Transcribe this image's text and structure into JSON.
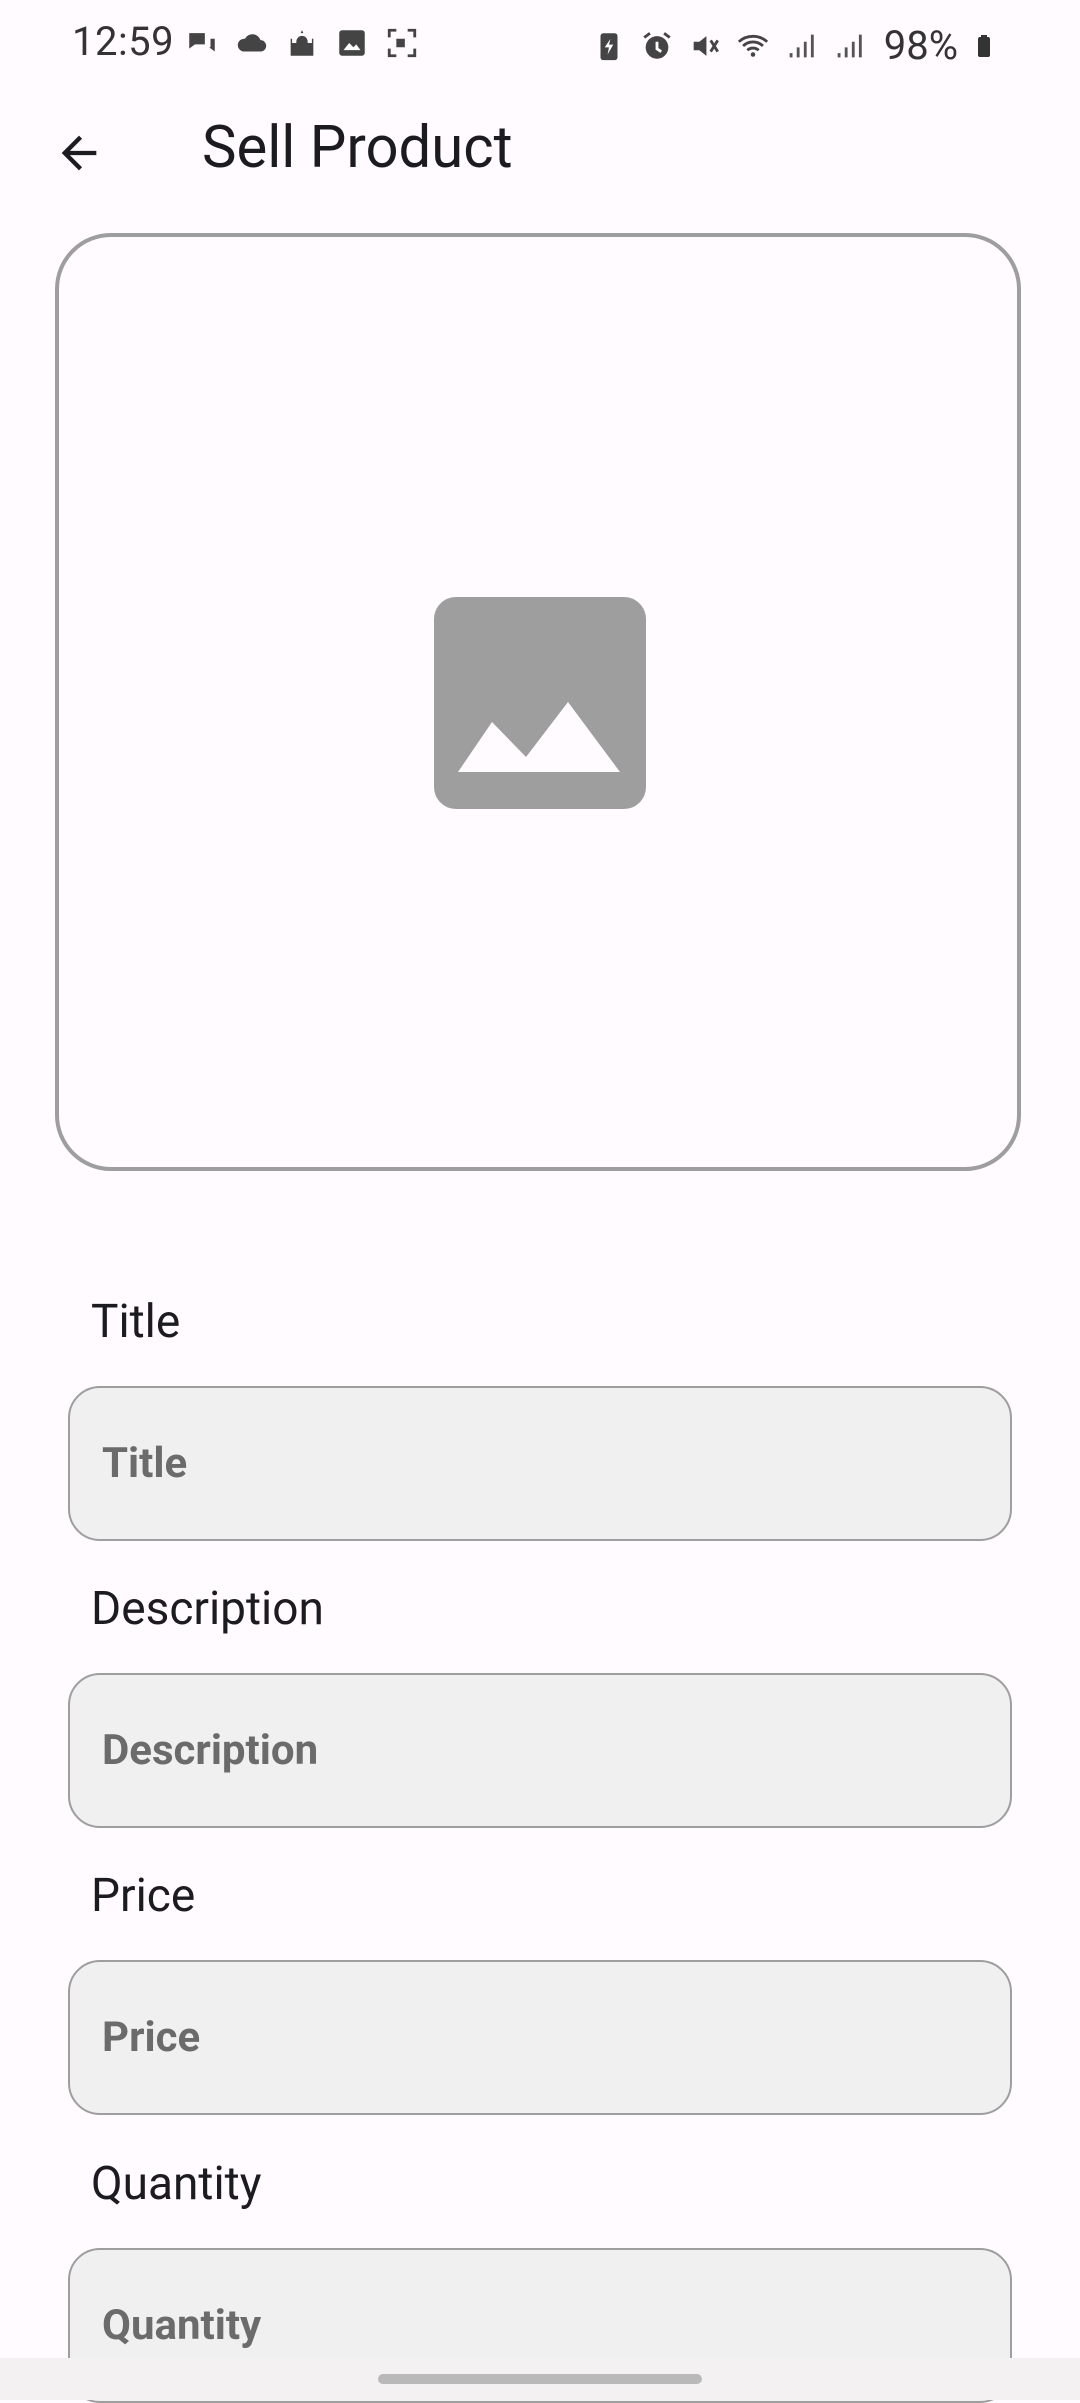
{
  "status_bar": {
    "time": "12:59",
    "battery": "98%",
    "left_icons": [
      "chat-bubbles-icon",
      "cloud-icon",
      "mosque-icon",
      "image-icon",
      "screen-record-icon"
    ],
    "right_icons": [
      "battery-saver-icon",
      "alarm-icon",
      "mute-icon",
      "wifi-icon",
      "signal-icon",
      "signal-icon-2",
      "battery-icon"
    ]
  },
  "app_bar": {
    "title": "Sell Product"
  },
  "image_picker": {
    "icon": "image-placeholder-icon",
    "icon_color": "#9e9e9e"
  },
  "form": {
    "title": {
      "label": "Title",
      "placeholder": "Title",
      "value": ""
    },
    "description": {
      "label": "Description",
      "placeholder": "Description",
      "value": ""
    },
    "price": {
      "label": "Price",
      "placeholder": "Price",
      "value": ""
    },
    "quantity": {
      "label": "Quantity",
      "placeholder": "Quantity",
      "value": ""
    }
  },
  "colors": {
    "background": "#fffbfe",
    "field_fill": "#f0f0f0",
    "border": "#9e9e9e"
  }
}
